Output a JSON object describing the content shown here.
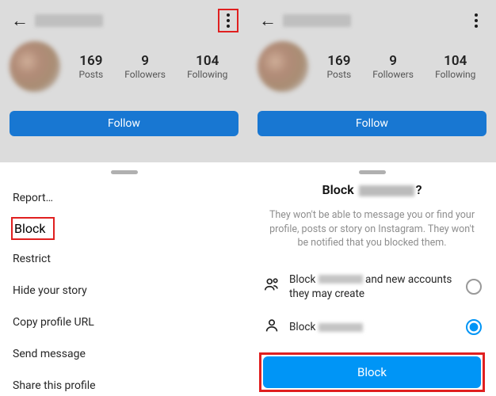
{
  "left": {
    "profile": {
      "stats": {
        "posts": {
          "value": "169",
          "label": "Posts"
        },
        "followers": {
          "value": "9",
          "label": "Followers"
        },
        "following": {
          "value": "104",
          "label": "Following"
        }
      },
      "follow_button": "Follow"
    },
    "menu": {
      "report": "Report…",
      "block": "Block",
      "restrict": "Restrict",
      "hide_story": "Hide your story",
      "copy_url": "Copy profile URL",
      "send_message": "Send message",
      "share_profile": "Share this profile"
    }
  },
  "right": {
    "profile": {
      "stats": {
        "posts": {
          "value": "169",
          "label": "Posts"
        },
        "followers": {
          "value": "9",
          "label": "Followers"
        },
        "following": {
          "value": "104",
          "label": "Following"
        }
      },
      "follow_button": "Follow"
    },
    "dialog": {
      "title_prefix": "Block ",
      "title_suffix": "?",
      "description": "They won't be able to message you or find your profile, posts or story on Instagram. They won't be notified that you blocked them.",
      "option1_prefix": "Block ",
      "option1_suffix": " and new accounts they may create",
      "option2_prefix": "Block ",
      "confirm": "Block"
    }
  }
}
